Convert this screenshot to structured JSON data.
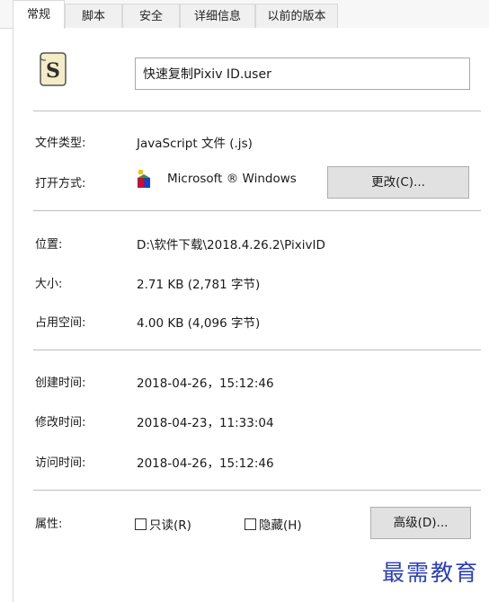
{
  "tabs": [
    {
      "label": "常规",
      "active": true
    },
    {
      "label": "脚本",
      "active": false
    },
    {
      "label": "安全",
      "active": false
    },
    {
      "label": "详细信息",
      "active": false
    },
    {
      "label": "以前的版本",
      "active": false
    }
  ],
  "file": {
    "icon": "script-file-icon",
    "name": "快速复制Pixiv ID.user"
  },
  "general": {
    "type_label": "文件类型:",
    "type_value": "JavaScript 文件 (.js)",
    "opens_with_label": "打开方式:",
    "opens_with_icon": "windows-script-host-icon",
    "opens_with_value": "Microsoft ® Windows",
    "change_button": "更改(C)..."
  },
  "location": {
    "location_label": "位置:",
    "location_value": "D:\\软件下载\\2018.4.26.2\\PixivID",
    "size_label": "大小:",
    "size_value": "2.71 KB (2,781 字节)",
    "size_on_disk_label": "占用空间:",
    "size_on_disk_value": "4.00 KB (4,096 字节)"
  },
  "dates": {
    "created_label": "创建时间:",
    "created_value": "2018-04-26，15:12:46",
    "modified_label": "修改时间:",
    "modified_value": "2018-04-23，11:33:04",
    "accessed_label": "访问时间:",
    "accessed_value": "2018-04-26，15:12:46"
  },
  "attributes": {
    "label": "属性:",
    "readonly_label": "只读(R)",
    "readonly_checked": false,
    "hidden_label": "隐藏(H)",
    "hidden_checked": false,
    "advanced_button": "高级(D)..."
  },
  "watermark": "最需教育"
}
